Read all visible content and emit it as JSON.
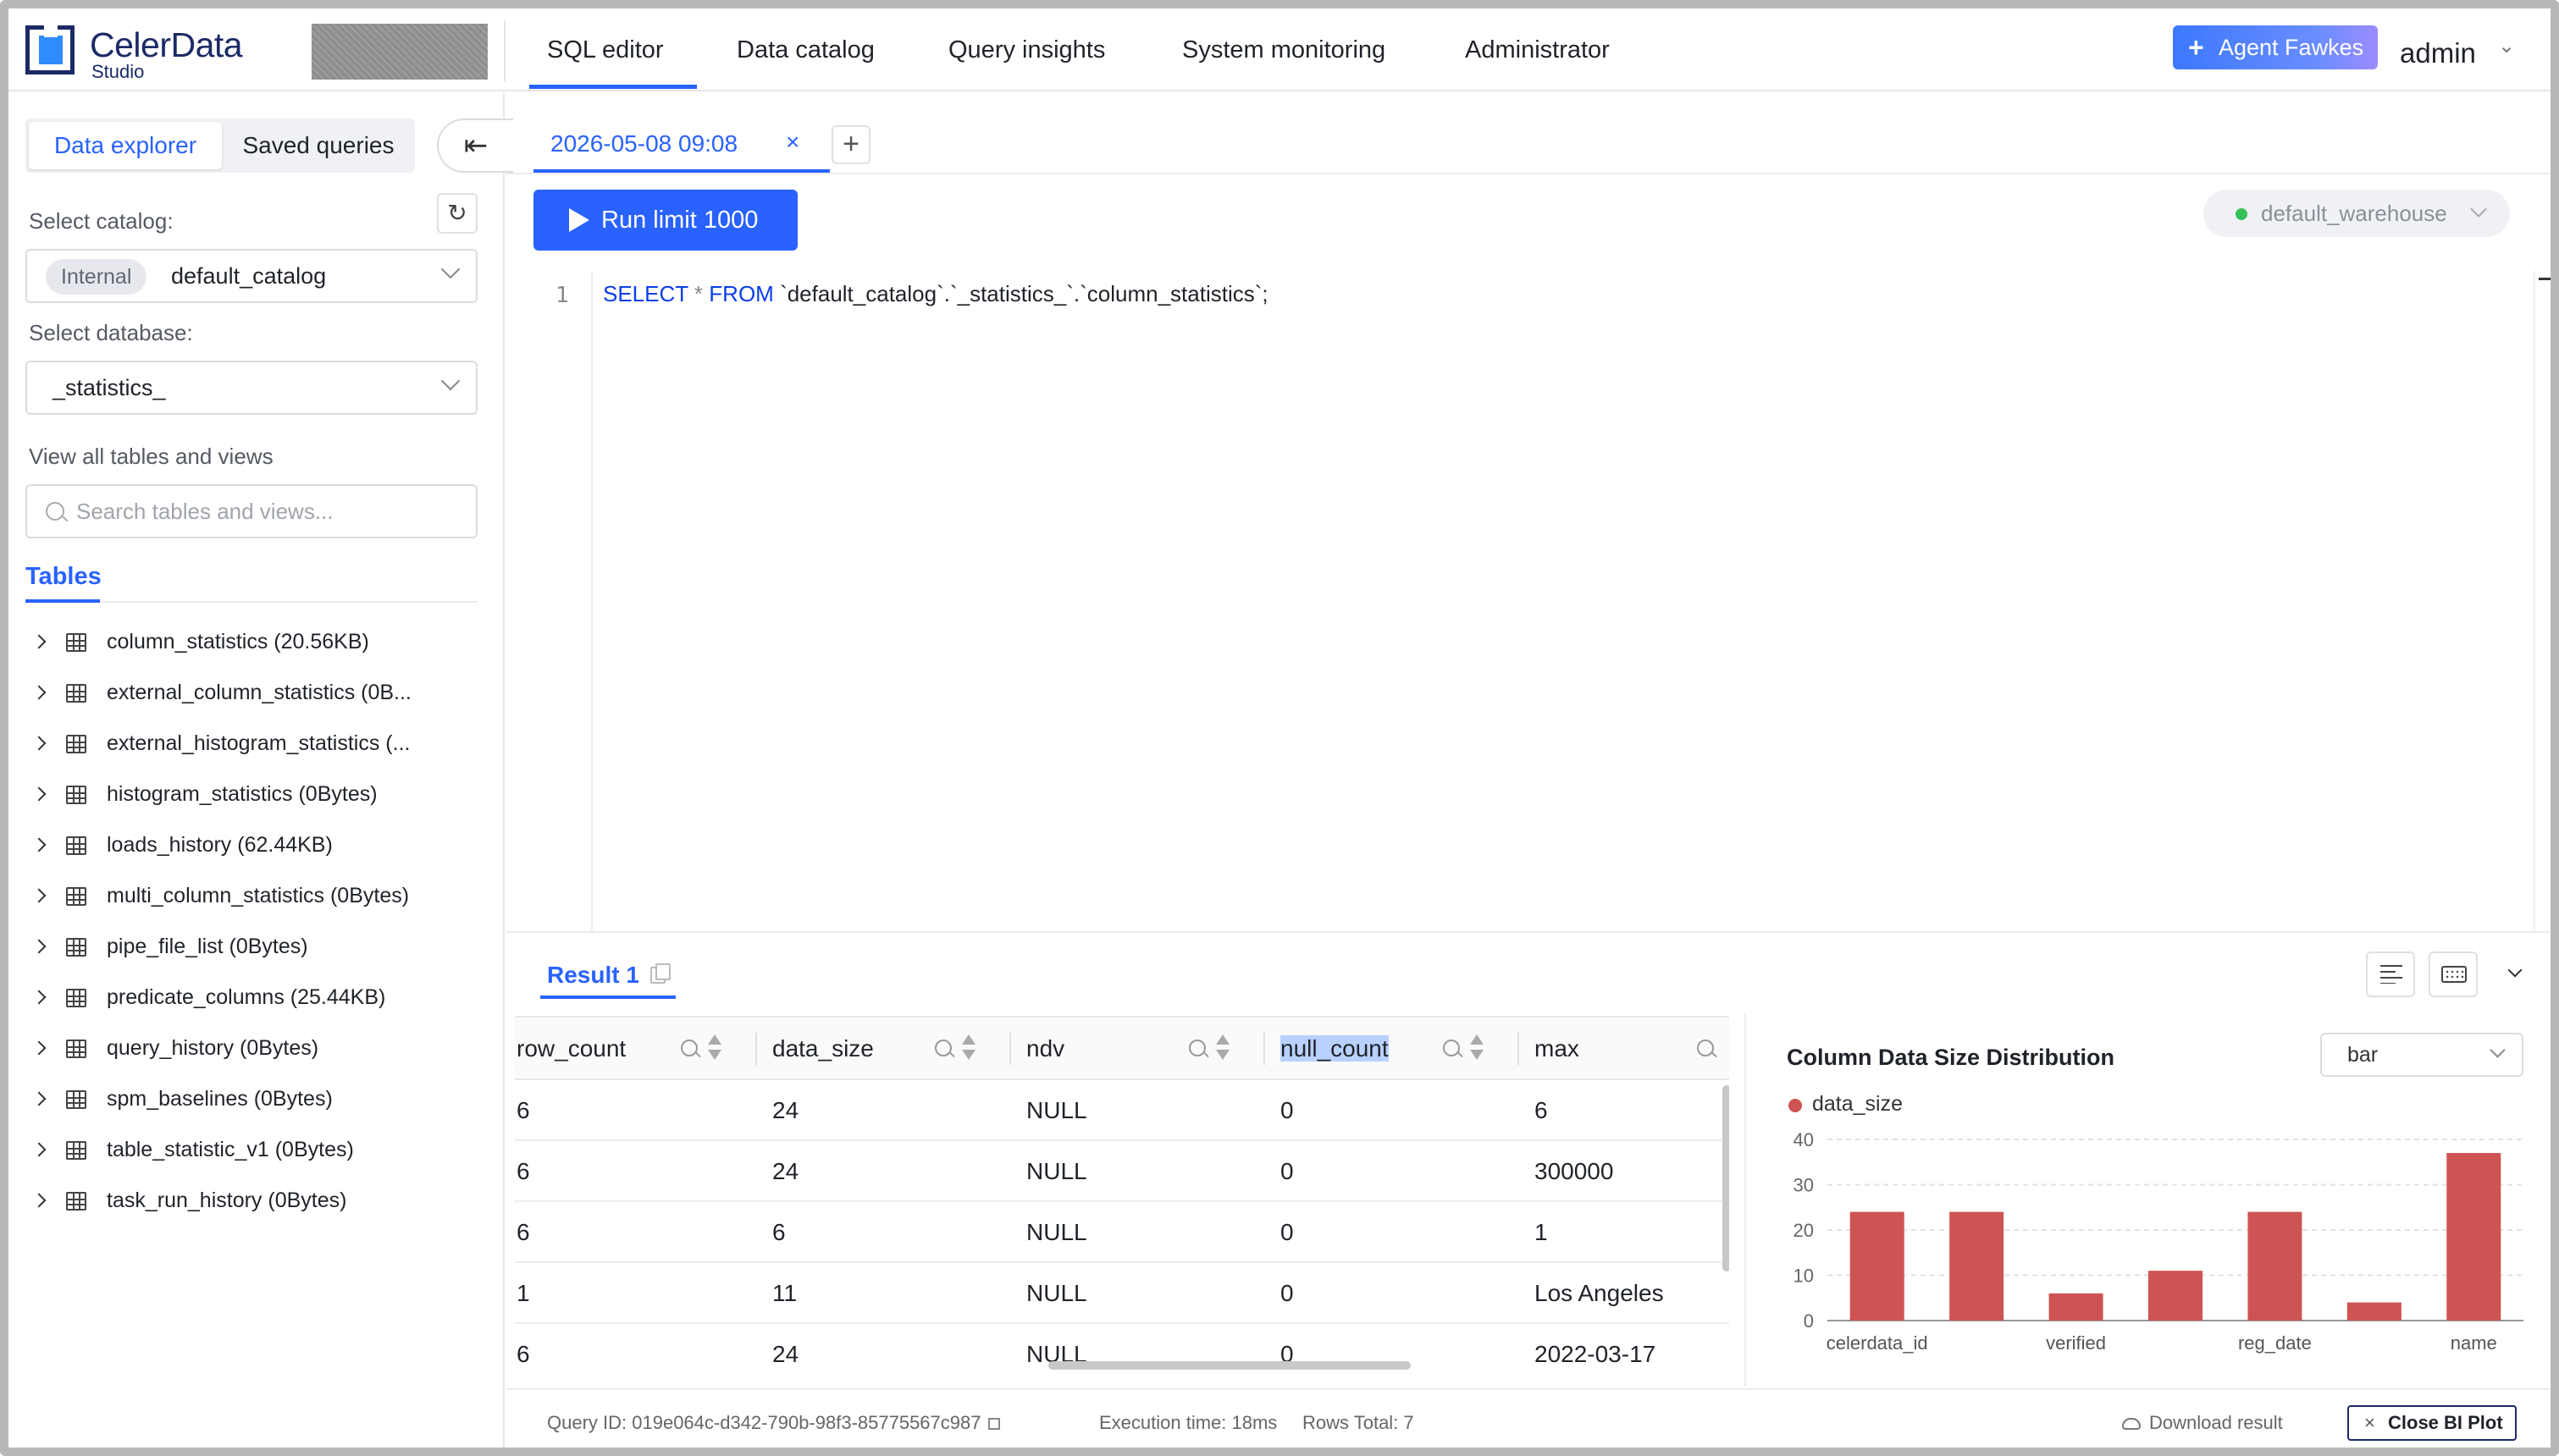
{
  "brand": {
    "name": "CelerData",
    "sub": "Studio"
  },
  "nav": {
    "tabs": [
      {
        "label": "SQL editor",
        "active": true
      },
      {
        "label": "Data catalog"
      },
      {
        "label": "Query insights"
      },
      {
        "label": "System monitoring"
      },
      {
        "label": "Administrator"
      }
    ],
    "agent_button": "Agent Fawkes",
    "user": "admin"
  },
  "sidebar": {
    "segments": [
      "Data explorer",
      "Saved queries"
    ],
    "catalog_label": "Select catalog:",
    "catalog_tag": "Internal",
    "catalog_value": "default_catalog",
    "database_label": "Select database:",
    "database_value": "_statistics_",
    "view_all": "View all tables and views",
    "search_placeholder": "Search tables and views...",
    "tables_heading": "Tables",
    "tables": [
      "column_statistics (20.56KB)",
      "external_column_statistics (0B...",
      "external_histogram_statistics (...",
      "histogram_statistics (0Bytes)",
      "loads_history (62.44KB)",
      "multi_column_statistics (0Bytes)",
      "pipe_file_list (0Bytes)",
      "predicate_columns (25.44KB)",
      "query_history (0Bytes)",
      "spm_baselines (0Bytes)",
      "table_statistic_v1 (0Bytes)",
      "task_run_history (0Bytes)"
    ]
  },
  "editor": {
    "tab_label": "2026-05-08 09:08",
    "run_button": "Run limit 1000",
    "warehouse": "default_warehouse",
    "line_number": "1",
    "code": {
      "kw1": "SELECT",
      "star": "*",
      "kw2": "FROM",
      "rest": "`default_catalog`.`_statistics_`.`column_statistics`;"
    }
  },
  "results": {
    "tab_label": "Result 1",
    "columns": [
      "row_count",
      "data_size",
      "ndv",
      "null_count",
      "max"
    ],
    "rows": [
      [
        "6",
        "24",
        "NULL",
        "0",
        "6"
      ],
      [
        "6",
        "24",
        "NULL",
        "0",
        "300000"
      ],
      [
        "6",
        "6",
        "NULL",
        "0",
        "1"
      ],
      [
        "1",
        "11",
        "NULL",
        "0",
        "Los Angeles"
      ],
      [
        "6",
        "24",
        "NULL",
        "0",
        "2022-03-17"
      ]
    ]
  },
  "chart": {
    "select_value": "bar",
    "bar_color": "#cd5453"
  },
  "chart_data": {
    "type": "bar",
    "title": "Column Data Size Distribution",
    "series": [
      {
        "name": "data_size",
        "values": [
          24,
          24,
          6,
          11,
          24,
          4,
          37
        ]
      }
    ],
    "categories": [
      "celerdata_id",
      "",
      "verified",
      "",
      "reg_date",
      "",
      "name"
    ],
    "yticks": [
      0,
      10,
      20,
      30,
      40
    ],
    "ylim": [
      0,
      40
    ],
    "grid": true,
    "legend": "top-left"
  },
  "footer": {
    "query_id": "Query ID:  019e064c-d342-790b-98f3-85775567c987",
    "exec_time": "Execution time: 18ms",
    "rows_total": "Rows Total: 7",
    "download": "Download result",
    "close_bi": "Close BI Plot"
  }
}
